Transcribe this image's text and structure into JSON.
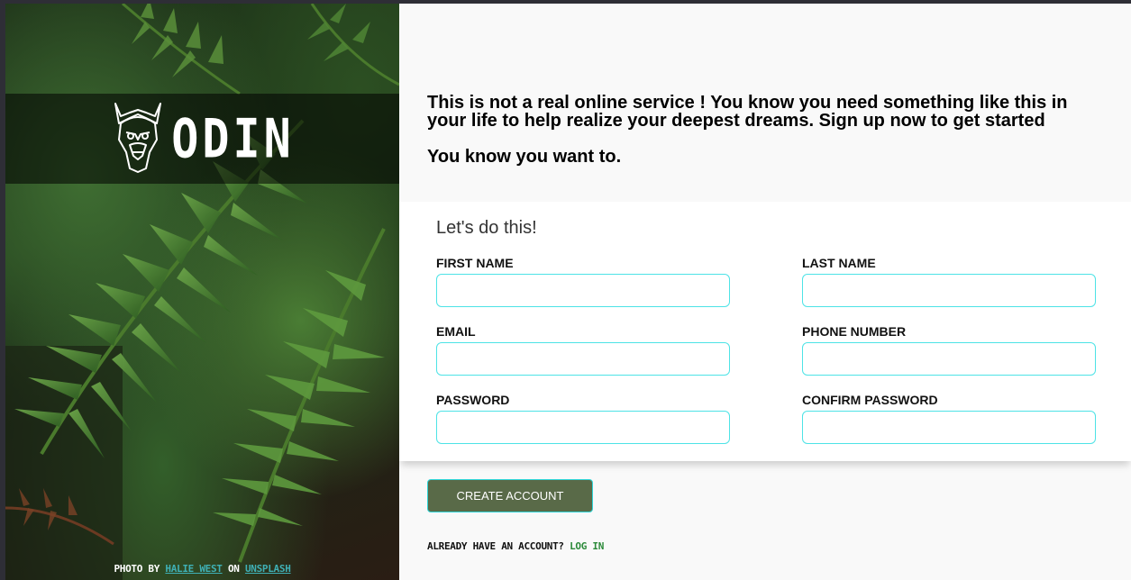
{
  "brand": {
    "name": "ODIN",
    "logo_icon": "viking-helmet-icon"
  },
  "photo_credit": {
    "prefix": "PHOTO BY",
    "author": "HALIE WEST",
    "middle": "ON",
    "site": "UNSPLASH"
  },
  "intro": {
    "paragraph1": "This is not a real online service ! You know you need something like this in your life to help realize your deepest dreams. Sign up now to get started",
    "paragraph2": "You know you want to."
  },
  "form": {
    "title": "Let's do this!",
    "fields": {
      "first_name": {
        "label": "FIRST NAME",
        "value": ""
      },
      "last_name": {
        "label": "LAST NAME",
        "value": ""
      },
      "email": {
        "label": "EMAIL",
        "value": ""
      },
      "phone": {
        "label": "PHONE NUMBER",
        "value": ""
      },
      "password": {
        "label": "PASSWORD",
        "value": ""
      },
      "confirm_password": {
        "label": "CONFIRM PASSWORD",
        "value": ""
      }
    },
    "submit_label": "CREATE ACCOUNT"
  },
  "login": {
    "prompt": "ALREADY HAVE AN ACCOUNT?",
    "link": "LOG IN"
  },
  "colors": {
    "input_border": "#4de3e6",
    "button_bg": "#596a48",
    "link_green": "#2c8a3a",
    "credit_link": "#3fb0b5"
  }
}
